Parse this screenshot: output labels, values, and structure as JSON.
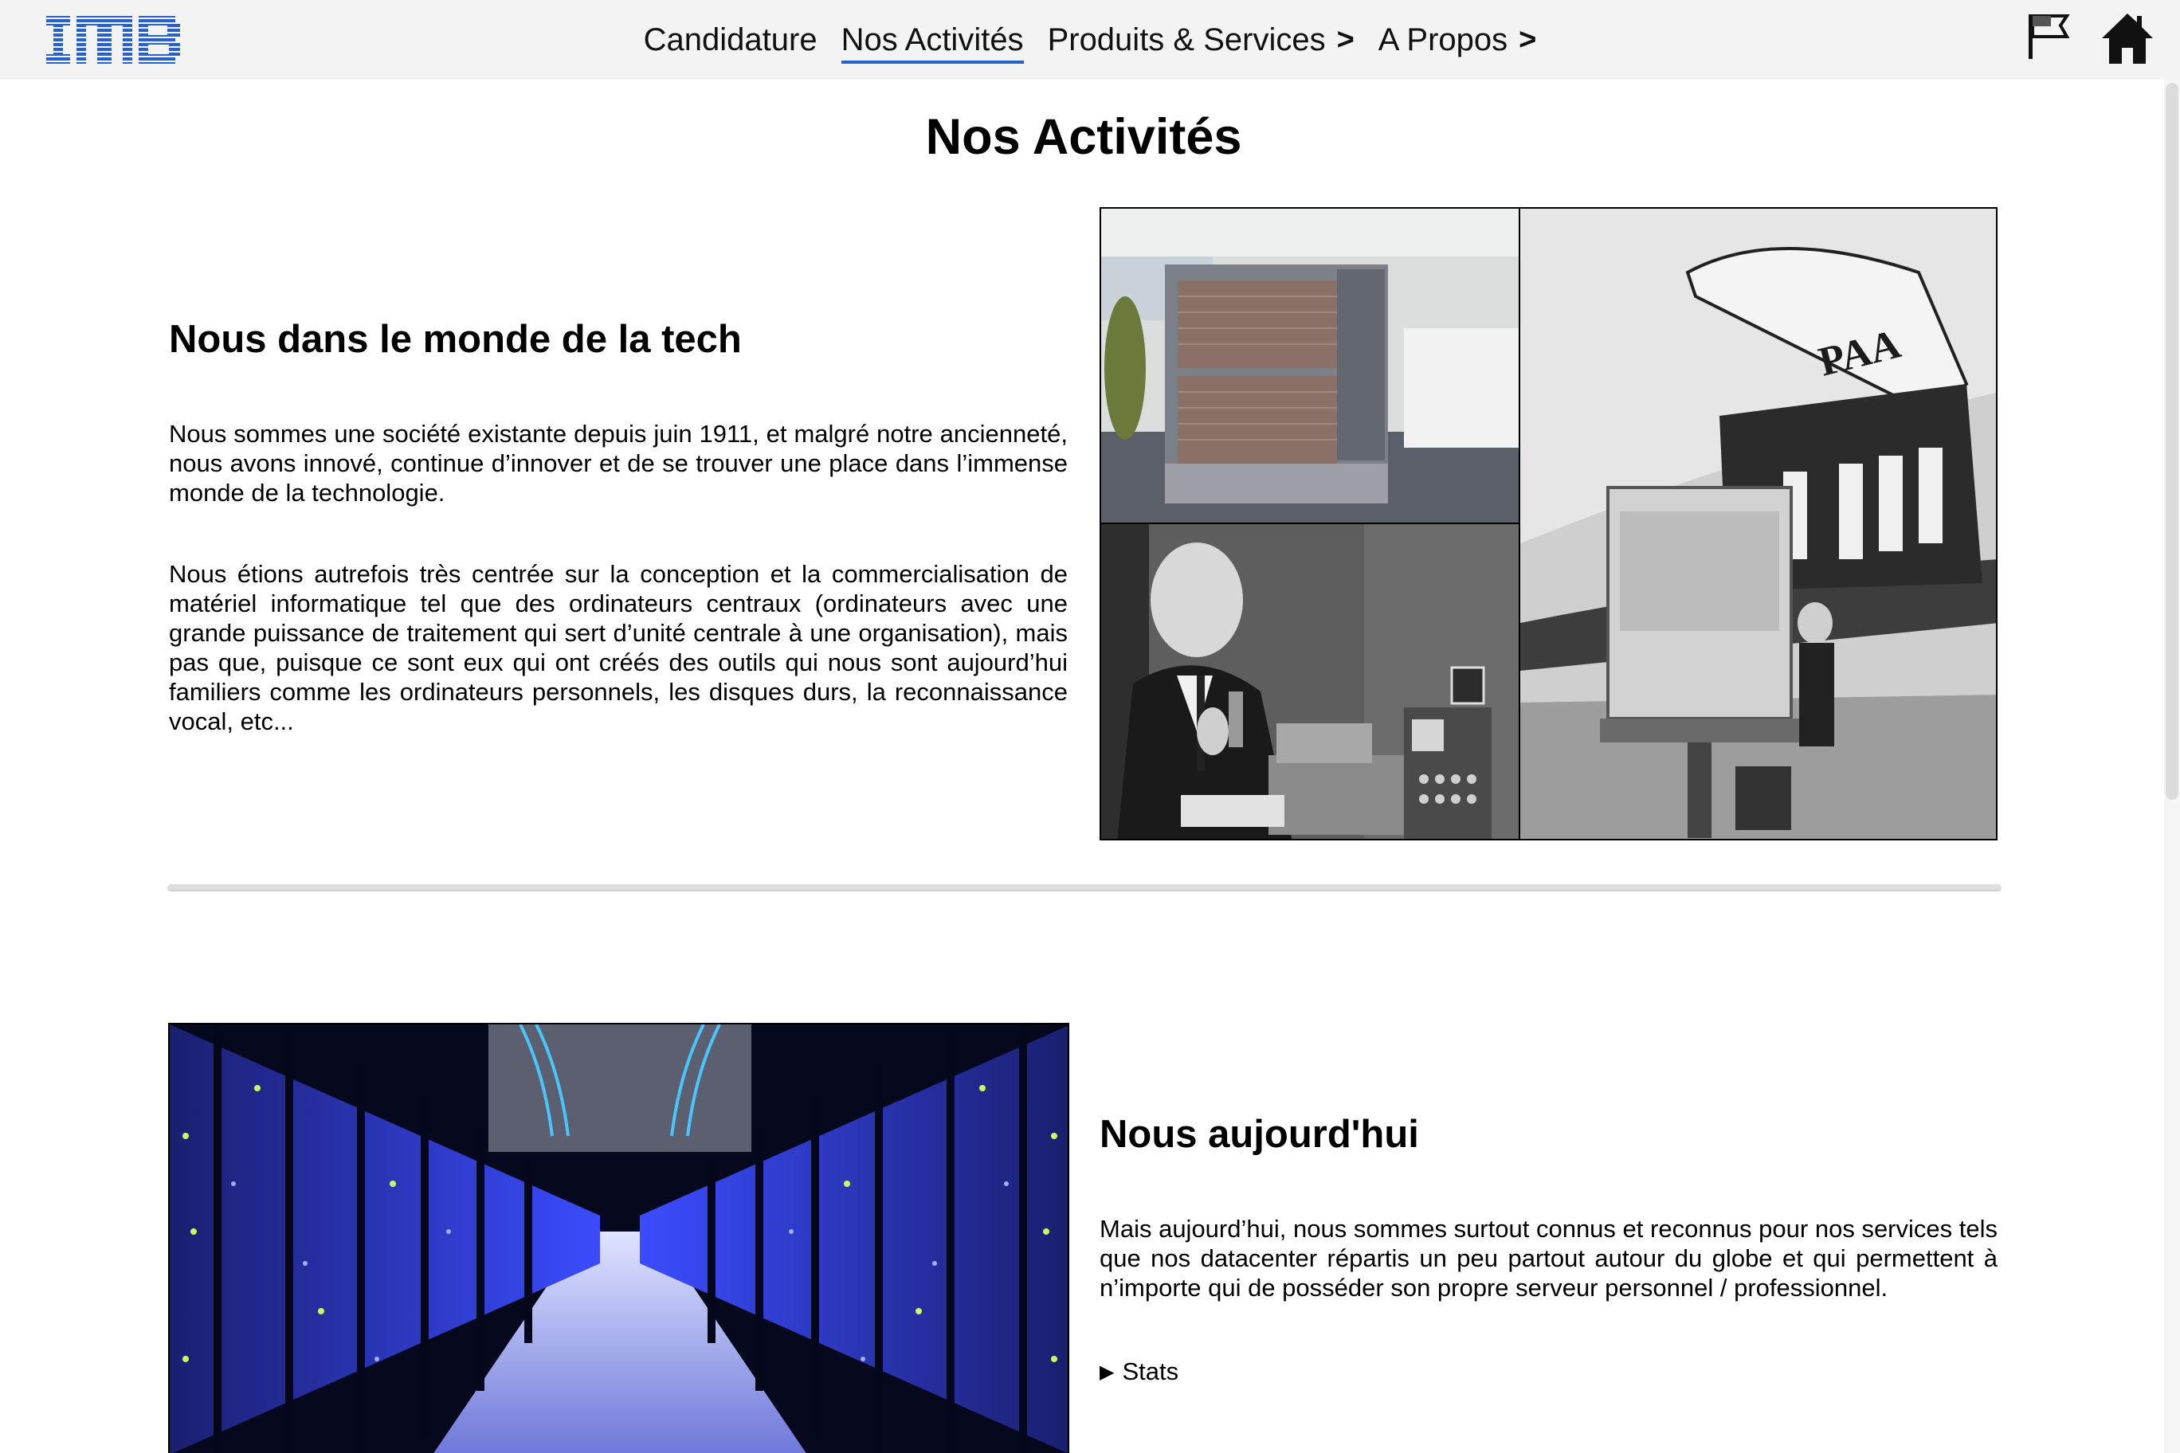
{
  "header": {
    "logo_text": "IMB",
    "nav": [
      {
        "label": "Candidature",
        "chevron": ""
      },
      {
        "label": "Nos Activités",
        "chevron": ""
      },
      {
        "label": "Produits & Services",
        "chevron": ">"
      },
      {
        "label": "A Propos",
        "chevron": ">"
      }
    ],
    "active_nav": "Nos Activités",
    "icons": [
      "flag-icon",
      "home-icon"
    ]
  },
  "page": {
    "title": "Nos Activités",
    "section1": {
      "heading": "Nous dans le monde de la tech",
      "paragraphs": [
        "Nous sommes une société existante depuis juin 1911, et malgré notre ancienneté, nous avons innové, continue d’innover et de se trouver une place dans l’immense monde de la technologie.",
        "Nous étions autrefois très centrée sur la conception et la commercialisation de matériel informatique tel que des ordinateurs centraux (ordinateurs avec une grande puissance de traitement qui sert d’unité centrale à une organisation), mais pas que, puisque ce sont eux qui ont créés des outils qui nous sont aujourd’hui familiers comme les ordinateurs personnels, les disques durs, la reconnaissance vocal, etc..."
      ],
      "collage_sign_text": "PAA"
    },
    "section2": {
      "heading": "Nous aujourd'hui",
      "paragraph": "Mais aujourd’hui, nous sommes surtout connus et reconnus pour nos services tels que nos datacenter répartis un peu partout autour du globe et qui permettent à n’importe qui de posséder son propre serveur personnel / professionnel.",
      "details_summary": "Stats"
    }
  },
  "colors": {
    "brand_blue": "#2962c6",
    "header_bg": "#f3f3f3",
    "datacenter_blue": "#3b4cff"
  }
}
